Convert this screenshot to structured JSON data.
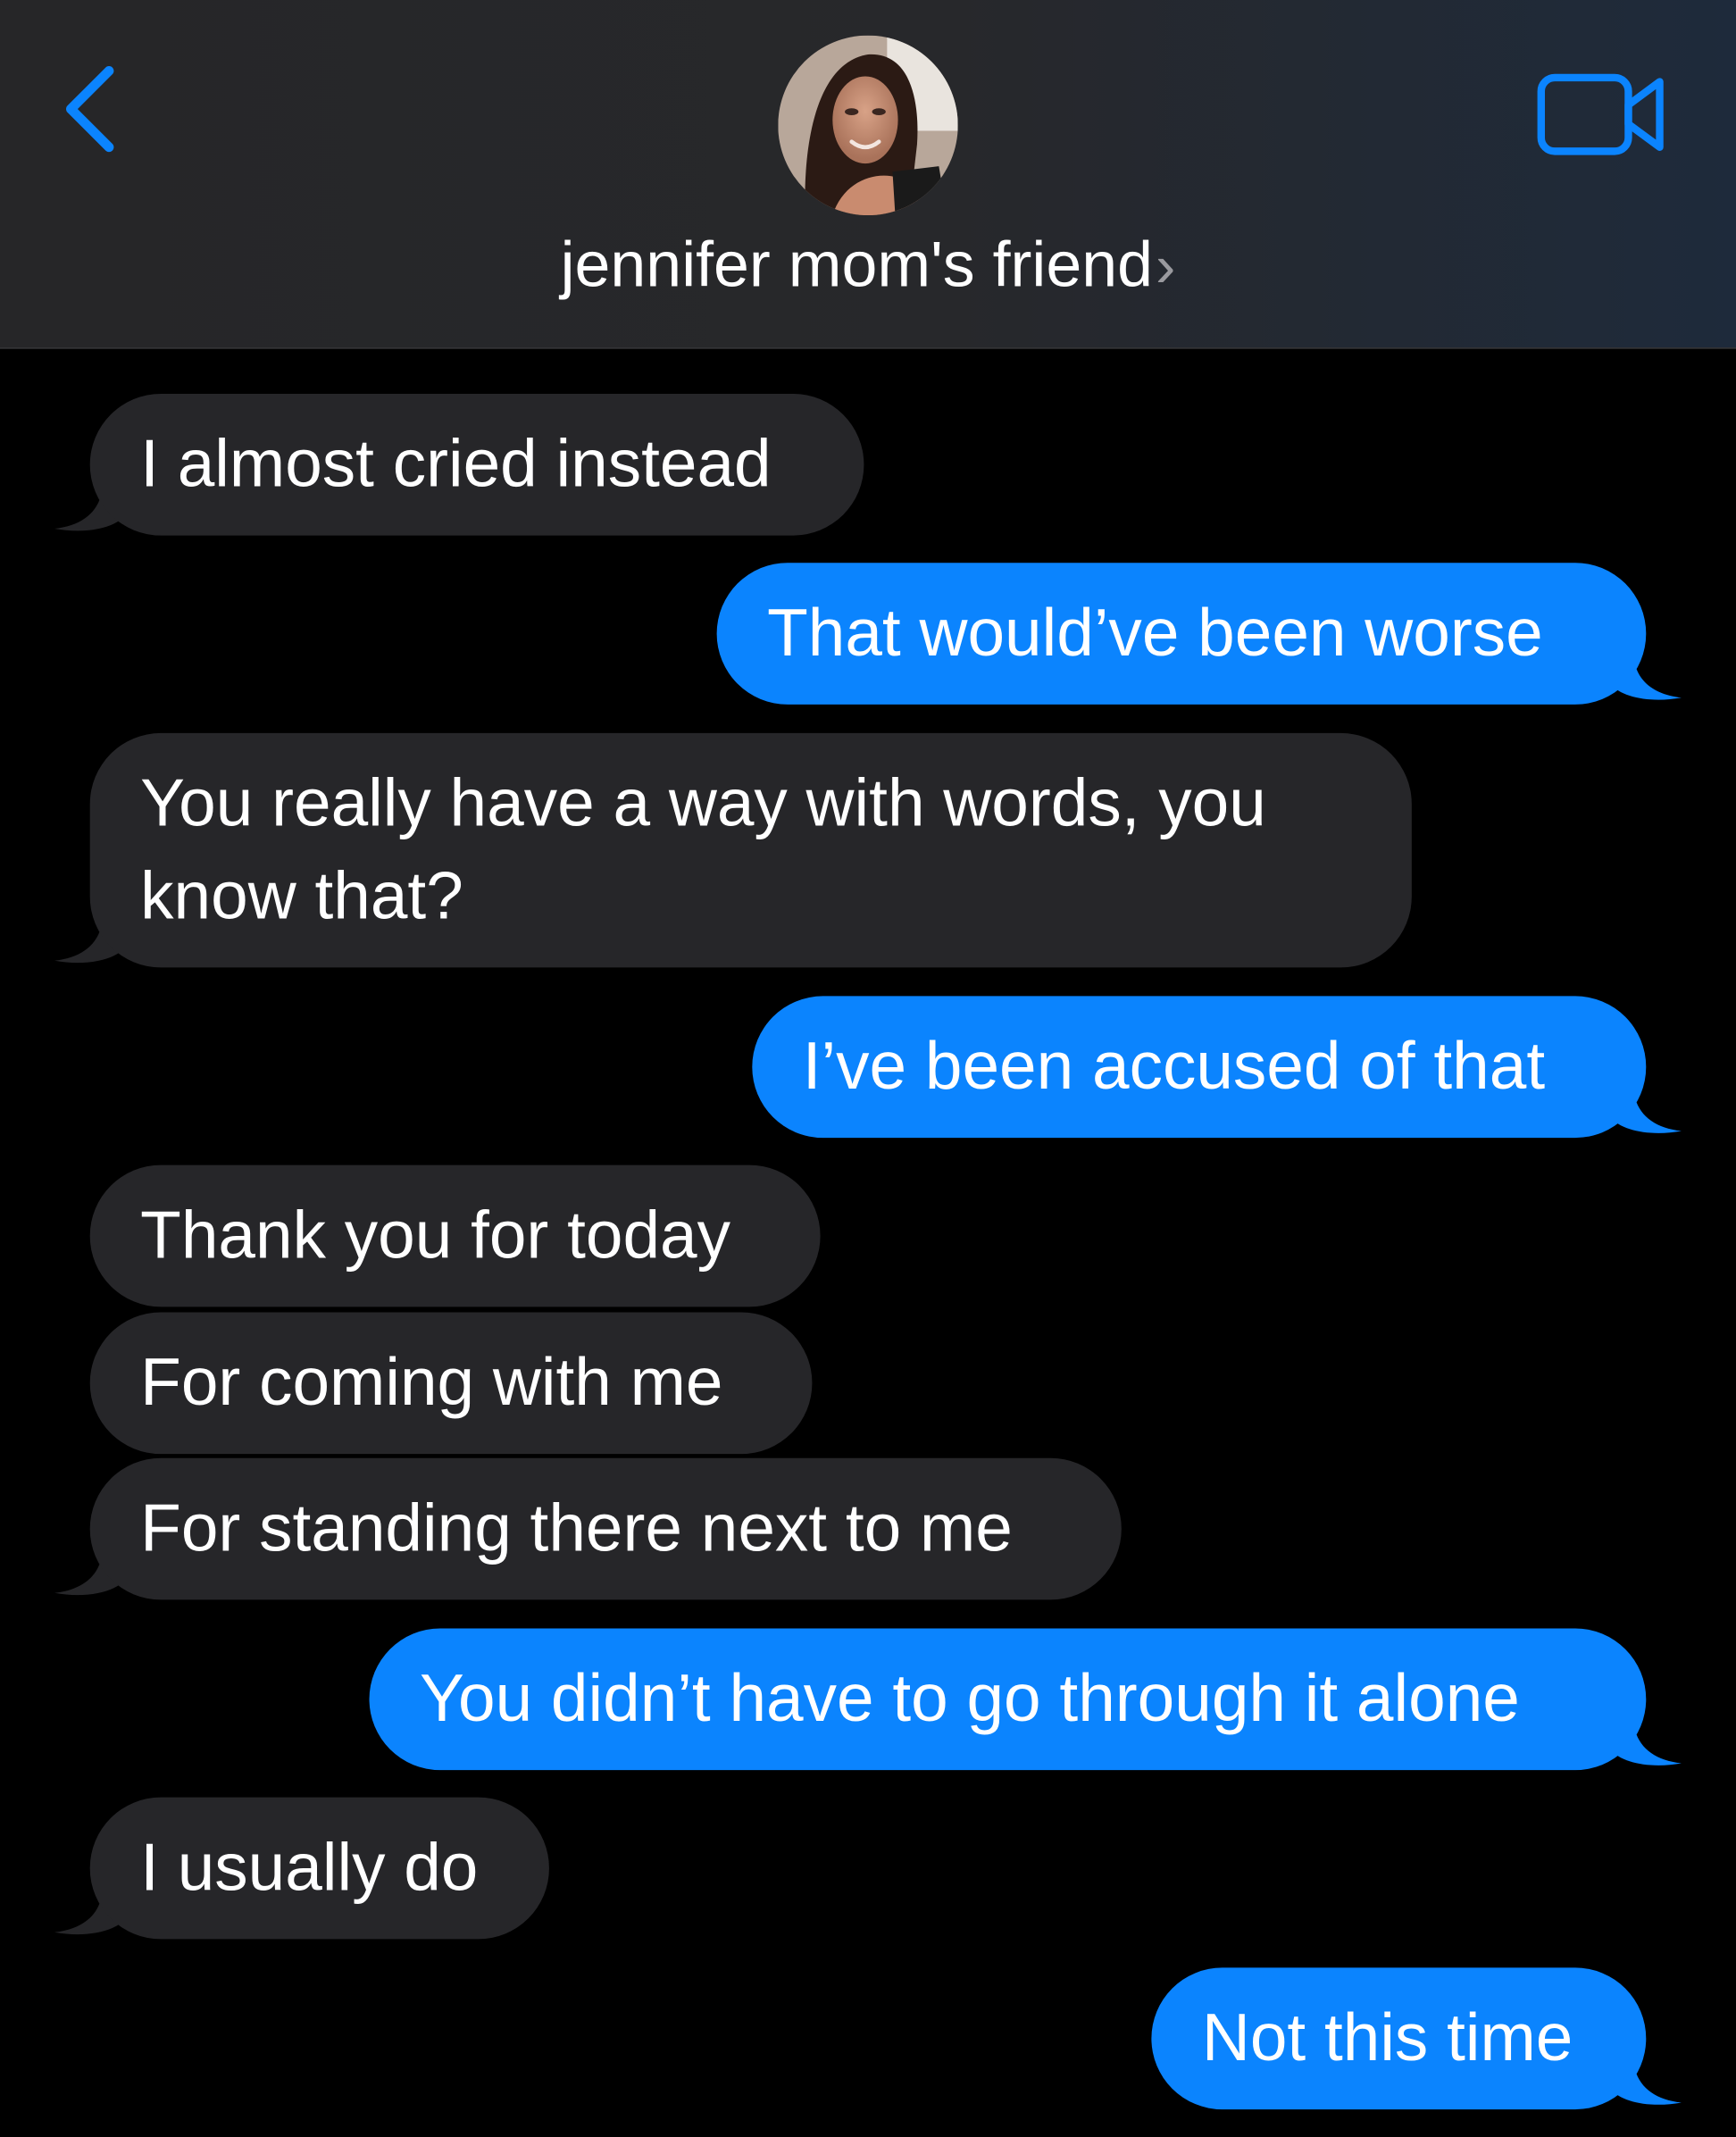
{
  "contact": {
    "name": "jennifer mom's friend",
    "chevron": "›",
    "avatar_icon": "person-photo-icon"
  },
  "header": {
    "back_icon": "chevron-left-icon",
    "video_icon": "video-camera-icon",
    "accent_color": "#0b84fe"
  },
  "colors": {
    "received_bubble": "#262629",
    "sent_bubble": "#0b84fe",
    "background": "#000000"
  },
  "messages": [
    {
      "from": "them",
      "text": "I almost cried instead"
    },
    {
      "from": "me",
      "text": "That would’ve been worse"
    },
    {
      "from": "them",
      "text": "You really have a way with words, you",
      "text2": "know that?"
    },
    {
      "from": "me",
      "text": "I’ve been accused of that"
    },
    {
      "from": "them",
      "text": "Thank you for today"
    },
    {
      "from": "them",
      "text": "For coming with me"
    },
    {
      "from": "them",
      "text": "For standing there next to me"
    },
    {
      "from": "me",
      "text": "You didn’t have to go through it alone"
    },
    {
      "from": "them",
      "text": "I usually do"
    },
    {
      "from": "me",
      "text": "Not this time"
    }
  ]
}
